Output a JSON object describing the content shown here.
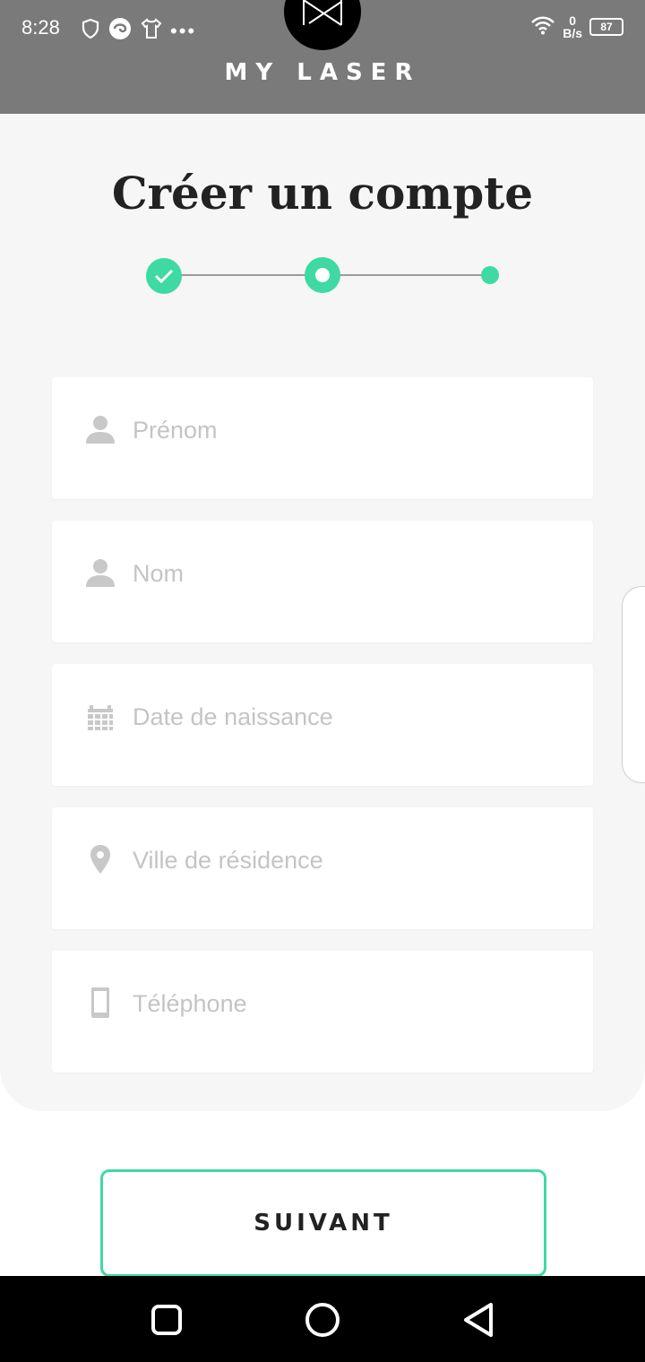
{
  "status_bar": {
    "time": "8:28",
    "network_speed_value": "0",
    "network_speed_unit": "B/s",
    "battery": "87",
    "icons": [
      "shield-icon",
      "swirl-icon",
      "tshirt-icon",
      "more-dots-icon",
      "wifi-icon"
    ]
  },
  "header": {
    "brand": "MY LASER"
  },
  "page": {
    "title": "Créer un compte",
    "stepper": {
      "total_steps": 3,
      "completed": 1,
      "current": 2
    }
  },
  "form": {
    "first_name": {
      "placeholder": "Prénom",
      "value": "",
      "icon": "person-icon"
    },
    "last_name": {
      "placeholder": "Nom",
      "value": "",
      "icon": "person-icon"
    },
    "birth_date": {
      "placeholder": "Date de naissance",
      "value": "",
      "icon": "calendar-icon"
    },
    "city": {
      "placeholder": "Ville de résidence",
      "value": "",
      "icon": "location-pin-icon"
    },
    "phone": {
      "placeholder": "Téléphone",
      "value": "",
      "icon": "mobile-phone-icon"
    }
  },
  "actions": {
    "next_label": "SUIVANT"
  },
  "colors": {
    "accent": "#3fd9a3",
    "header_bg": "#7a7a7a",
    "card_bg": "#f6f6f6",
    "placeholder": "#c4c4c4"
  },
  "nav_bar": {
    "buttons": [
      "recent-apps-icon",
      "home-icon",
      "back-icon"
    ]
  }
}
